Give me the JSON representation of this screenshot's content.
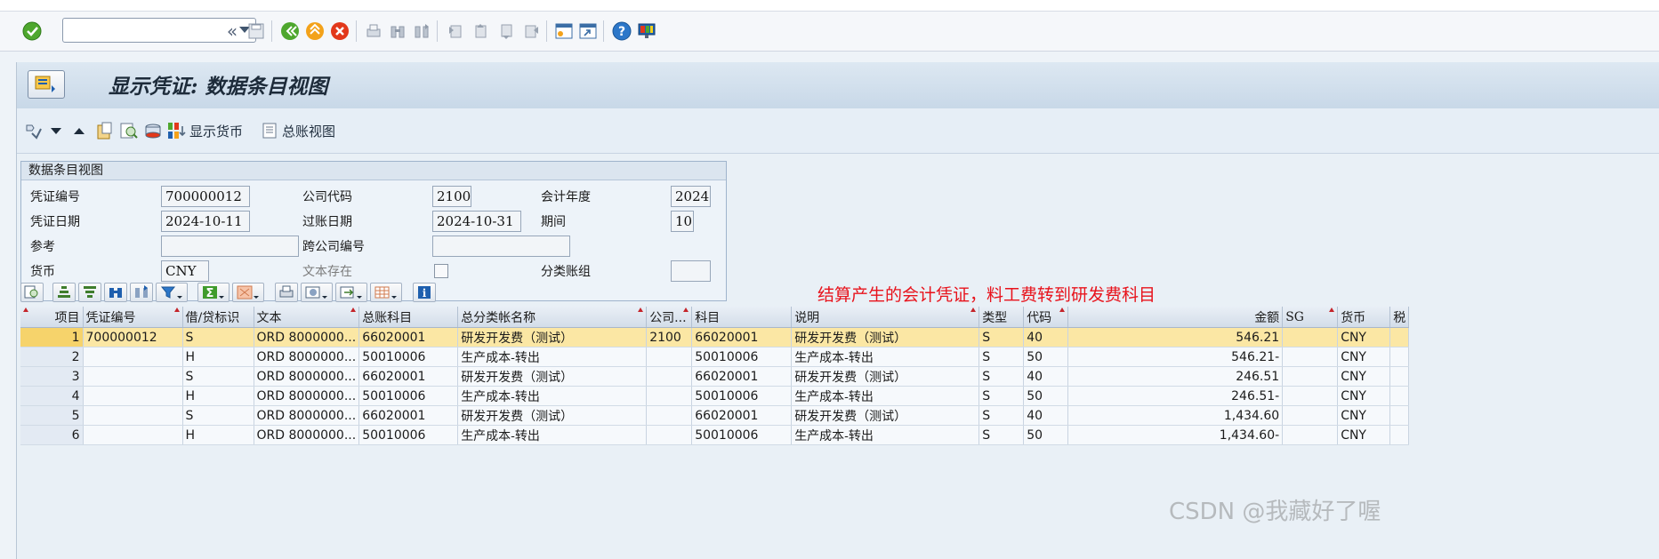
{
  "toolbar": {
    "command_field_value": "",
    "icons": [
      "enter-check-icon",
      "command-dropdown-icon",
      "collapse-icon",
      "save-icon",
      "back-icon",
      "exit-icon",
      "cancel-icon",
      "print-icon",
      "find-icon",
      "find-next-icon",
      "first-page-icon",
      "previous-page-icon",
      "next-page-icon",
      "last-page-icon",
      "create-session-icon",
      "shortcut-icon",
      "help-icon",
      "customize-layout-icon"
    ]
  },
  "title": "显示凭证: 数据条目视图",
  "app_toolbar": {
    "display_currency_label": "显示货币",
    "general_ledger_view_label": "总账视图"
  },
  "header_form": {
    "section_title": "数据条目视图",
    "fields": {
      "doc_number": {
        "label": "凭证编号",
        "value": "700000012"
      },
      "company_code": {
        "label": "公司代码",
        "value": "2100"
      },
      "fiscal_year": {
        "label": "会计年度",
        "value": "2024"
      },
      "doc_date": {
        "label": "凭证日期",
        "value": "2024-10-11"
      },
      "posting_date": {
        "label": "过账日期",
        "value": "2024-10-31"
      },
      "period": {
        "label": "期间",
        "value": "10"
      },
      "reference": {
        "label": "参考",
        "value": ""
      },
      "cross_company_no": {
        "label": "跨公司编号",
        "value": ""
      },
      "currency": {
        "label": "货币",
        "value": "CNY"
      },
      "text_exists": {
        "label": "文本存在",
        "checked": false
      },
      "ledger_group": {
        "label": "分类账组",
        "value": ""
      }
    }
  },
  "annotation": "结算产生的会计凭证，料工费转到研发费科目",
  "grid": {
    "columns": [
      "项目",
      "凭证编号",
      "借/贷标识",
      "文本",
      "总账科目",
      "总分类帐名称",
      "公司...",
      "科目",
      "说明",
      "类型",
      "代码",
      "金额",
      "SG",
      "货币",
      "税"
    ],
    "rows": [
      {
        "item": "1",
        "doc": "700000012",
        "dc": "S",
        "text": "ORD 8000000...",
        "gl": "66020001",
        "gl_name": "研发开发费（测试）",
        "cc": "2100",
        "acct": "66020001",
        "desc": "研发开发费（测试）",
        "type": "S",
        "code": "40",
        "amount": "546.21",
        "sg": "",
        "cur": "CNY",
        "tax": ""
      },
      {
        "item": "2",
        "doc": "",
        "dc": "H",
        "text": "ORD 8000000...",
        "gl": "50010006",
        "gl_name": "生产成本-转出",
        "cc": "",
        "acct": "50010006",
        "desc": "生产成本-转出",
        "type": "S",
        "code": "50",
        "amount": "546.21-",
        "sg": "",
        "cur": "CNY",
        "tax": ""
      },
      {
        "item": "3",
        "doc": "",
        "dc": "S",
        "text": "ORD 8000000...",
        "gl": "66020001",
        "gl_name": "研发开发费（测试）",
        "cc": "",
        "acct": "66020001",
        "desc": "研发开发费（测试）",
        "type": "S",
        "code": "40",
        "amount": "246.51",
        "sg": "",
        "cur": "CNY",
        "tax": ""
      },
      {
        "item": "4",
        "doc": "",
        "dc": "H",
        "text": "ORD 8000000...",
        "gl": "50010006",
        "gl_name": "生产成本-转出",
        "cc": "",
        "acct": "50010006",
        "desc": "生产成本-转出",
        "type": "S",
        "code": "50",
        "amount": "246.51-",
        "sg": "",
        "cur": "CNY",
        "tax": ""
      },
      {
        "item": "5",
        "doc": "",
        "dc": "S",
        "text": "ORD 8000000...",
        "gl": "66020001",
        "gl_name": "研发开发费（测试）",
        "cc": "",
        "acct": "66020001",
        "desc": "研发开发费（测试）",
        "type": "S",
        "code": "40",
        "amount": "1,434.60",
        "sg": "",
        "cur": "CNY",
        "tax": ""
      },
      {
        "item": "6",
        "doc": "",
        "dc": "H",
        "text": "ORD 8000000...",
        "gl": "50010006",
        "gl_name": "生产成本-转出",
        "cc": "",
        "acct": "50010006",
        "desc": "生产成本-转出",
        "type": "S",
        "code": "50",
        "amount": "1,434.60-",
        "sg": "",
        "cur": "CNY",
        "tax": ""
      }
    ],
    "selected_row": 0
  },
  "watermark": "CSDN @我藏好了喔",
  "colors": {
    "title_bar": "#c8d8e8",
    "selected_row": "#fbe7a4",
    "annotation": "#e8121b"
  }
}
